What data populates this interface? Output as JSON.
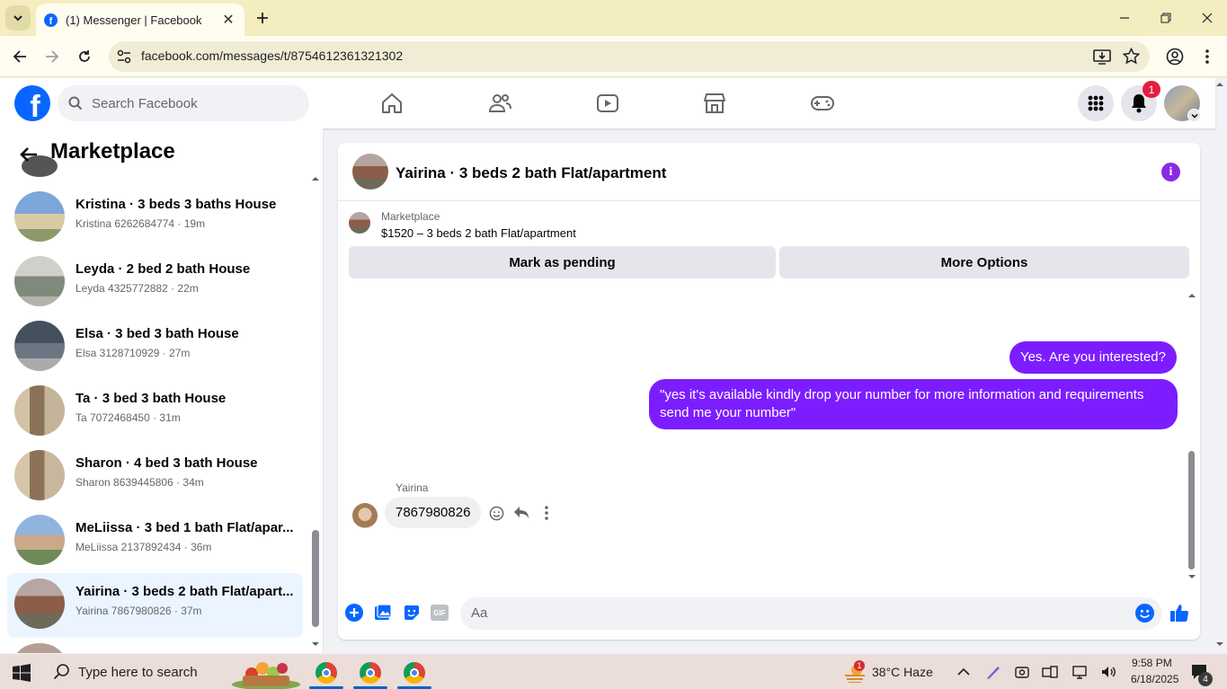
{
  "browser": {
    "tab_title": "(1) Messenger | Facebook",
    "favicon": "f",
    "url": "facebook.com/messages/t/8754612361321302",
    "accent_color": "#f3edbf"
  },
  "fb_header": {
    "logo_letter": "f",
    "search_placeholder": "Search Facebook",
    "notifications_badge": "1",
    "brand_color": "#0866ff"
  },
  "sidebar": {
    "title": "Marketplace",
    "conversations": [
      {
        "title": "Kristina · 3 beds 3 baths House",
        "subtitle": "Kristina 6262684774 · 19m",
        "active": false
      },
      {
        "title": "Leyda · 2 bed 2 bath House",
        "subtitle": "Leyda 4325772882 · 22m",
        "active": false
      },
      {
        "title": "Elsa · 3 bed 3 bath House",
        "subtitle": "Elsa 3128710929 · 27m",
        "active": false
      },
      {
        "title": "Ta · 3 bed 3 bath House",
        "subtitle": "Ta 7072468450 · 31m",
        "active": false
      },
      {
        "title": "Sharon · 4 bed 3 bath House",
        "subtitle": "Sharon 8639445806 · 34m",
        "active": false
      },
      {
        "title": "MeLiissa · 3 bed 1 bath Flat/apar...",
        "subtitle": "MeLiissa 2137892434 · 36m",
        "active": false
      },
      {
        "title": "Yairina · 3 beds 2 bath Flat/apart...",
        "subtitle": "Yairina 7867980826 · 37m",
        "active": true
      }
    ]
  },
  "chat": {
    "title": "Yairina · 3 beds 2 bath Flat/apartment",
    "marketplace_label": "Marketplace",
    "listing": "$1520 – 3 beds 2 bath Flat/apartment",
    "mark_pending_label": "Mark as pending",
    "more_options_label": "More Options",
    "info_icon_char": "i",
    "messages": {
      "out1": "Yes. Are you interested?",
      "out2": "\"yes it's available kindly drop your number for more information and requirements send me your number\"",
      "in_sender": "Yairina",
      "in_text": "7867980826"
    },
    "composer_placeholder": "Aa",
    "gif_label": "GIF",
    "accent_color": "#7c1dff"
  },
  "taskbar": {
    "search_placeholder": "Type here to search",
    "weather_badge": "1",
    "weather": "38°C  Haze",
    "time": "9:58 PM",
    "date": "6/18/2025",
    "notification_count": "4"
  }
}
